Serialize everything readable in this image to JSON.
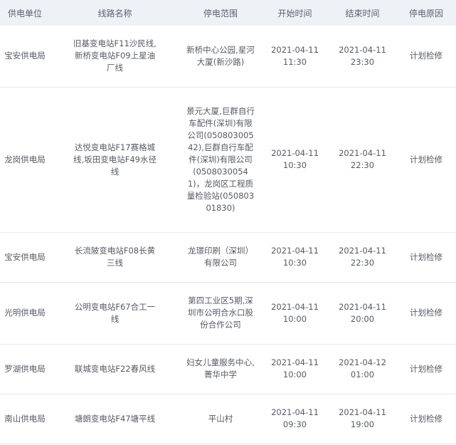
{
  "headers": {
    "unit": "供电单位",
    "line": "线路名称",
    "range": "停电范围",
    "start": "开始时间",
    "end": "结束时间",
    "reason": "停电原因"
  },
  "rows": [
    {
      "unit": "宝安供电局",
      "line": "旧基变电站F11沙民线,新桥变电站F09上星油厂线",
      "range": "新桥中心公园,星河大厦(新沙路)",
      "start_date": "2021-04-11",
      "start_time": "11:30",
      "end_date": "2021-04-11",
      "end_time": "23:30",
      "reason": "计划检修"
    },
    {
      "unit": "龙岗供电局",
      "line": "达悦变电站F17赛格城线,坂田变电站F49水径线",
      "range": "景元大厦,巨群自行车配件(深圳)有限公司(05080300542),巨群自行车配件(深圳)有限公司(05080300541)，龙岗区工程质量检验站(05080301830)",
      "start_date": "2021-04-11",
      "start_time": "10:30",
      "end_date": "2021-04-11",
      "end_time": "22:30",
      "reason": "计划检修"
    },
    {
      "unit": "宝安供电局",
      "line": "长流陂变电站F08长黄三线",
      "range": "龙璟印刷（深圳）有限公司",
      "start_date": "2021-04-11",
      "start_time": "10:30",
      "end_date": "2021-04-11",
      "end_time": "22:30",
      "reason": "计划检修"
    },
    {
      "unit": "光明供电局",
      "line": "公明变电站F67合工一线",
      "range": "第四工业区5期,深圳市公明合水口股份合作公司",
      "start_date": "2021-04-11",
      "start_time": "10:00",
      "end_date": "2021-04-11",
      "end_time": "20:00",
      "reason": "计划检修"
    },
    {
      "unit": "罗湖供电局",
      "line": "联城变电站F22春风线",
      "range": "妇女儿童服务中心,菁华中学",
      "start_date": "2021-04-11",
      "start_time": "10:00",
      "end_date": "2021-04-12",
      "end_time": "01:00",
      "reason": "计划检修"
    },
    {
      "unit": "南山供电局",
      "line": "塘朗变电站F47塘平线",
      "range": "平山村",
      "start_date": "2021-04-11",
      "start_time": "09:30",
      "end_date": "2021-04-11",
      "end_time": "19:00",
      "reason": "计划检修"
    }
  ]
}
